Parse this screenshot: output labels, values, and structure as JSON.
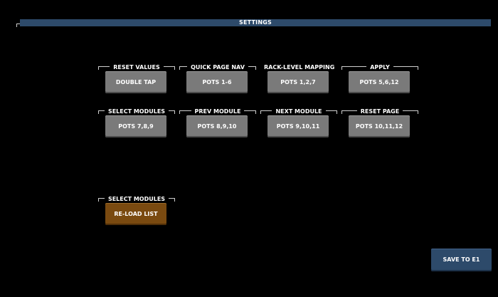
{
  "header": {
    "title": "SETTINGS",
    "color": "#2d4a6a"
  },
  "groups": [
    {
      "label": "RESET VALUES",
      "button": "DOUBLE TAP"
    },
    {
      "label": "QUICK PAGE NAV",
      "button": "POTS 1-6"
    },
    {
      "label": "RACK-LEVEL MAPPING",
      "button": "POTS 1,2,7"
    },
    {
      "label": "APPLY",
      "button": "POTS 5,6,12"
    },
    {
      "label": "SELECT MODULES",
      "button": "POTS 7,8,9"
    },
    {
      "label": "PREV MODULE",
      "button": "POTS 8,9,10"
    },
    {
      "label": "NEXT MODULE",
      "button": "POTS 9,10,11"
    },
    {
      "label": "RESET PAGE",
      "button": "POTS 10,11,12"
    }
  ],
  "modules": {
    "label": "SELECT MODULES",
    "button": "RE-LOAD LIST",
    "color": "#7a4a10"
  },
  "save": {
    "label": "SAVE TO E1",
    "color": "#2d4a6a"
  },
  "colors": {
    "button_gray": "#7a7a7a",
    "background": "#000000"
  }
}
